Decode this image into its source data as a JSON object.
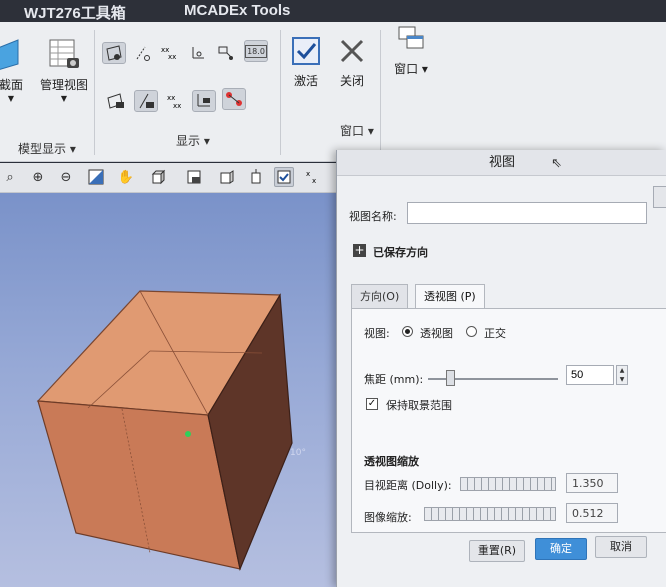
{
  "titlebar": {
    "tabs": [
      "WJT276工具箱",
      "MCADEx Tools"
    ]
  },
  "ribbon": {
    "section_label": "截面",
    "model_view_label": "管理视图",
    "model_display_group": "模型显示",
    "display_group": "显示",
    "activate_label": "激活",
    "close_label": "关闭",
    "window_label": "窗口",
    "window_group": "窗口",
    "datum_count": "18.0"
  },
  "viewport": {
    "dim_label": "10°"
  },
  "dialog": {
    "title": "视图",
    "view_name_label": "视图名称:",
    "view_name_value": "",
    "saved_orientations": "已保存方向",
    "tabs": [
      "方向(O)",
      "透视图 (P)"
    ],
    "view_label": "视图:",
    "perspective_option": "透视图",
    "orthographic_option": "正交",
    "focal_label": "焦距 (mm):",
    "focal_value": "50",
    "keep_clip_label": "保持取景范围",
    "zoom_section": "透视图缩放",
    "eye_distance_label": "目视距离 (Dolly):",
    "eye_distance_value": "1.350",
    "image_zoom_label": "图像缩放:",
    "image_zoom_value": "0.512",
    "reset_button": "重置(R)",
    "ok_button": "确定",
    "cancel_button": "取消"
  },
  "colors": {
    "accent": "#3f8fd8",
    "box_face": "#d9875f",
    "viewport_top": "#7a92c9"
  }
}
